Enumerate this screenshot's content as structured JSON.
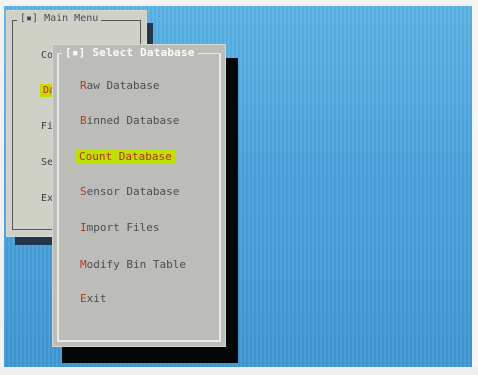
{
  "main_menu": {
    "title": "[▪] Main Menu",
    "items": [
      {
        "label": "Co"
      },
      {
        "label": "Da"
      },
      {
        "label": "Fi"
      },
      {
        "label": "Se"
      },
      {
        "label": "Ex"
      }
    ],
    "selected_index": 1
  },
  "db_dialog": {
    "title": "[▪] Select Database",
    "items": [
      {
        "hot": "R",
        "rest": "aw Database"
      },
      {
        "hot": "B",
        "rest": "inned Database"
      },
      {
        "hot": "C",
        "rest": "ount Database"
      },
      {
        "hot": "S",
        "rest": "ensor Database"
      },
      {
        "hot": "I",
        "rest": "mport Files"
      },
      {
        "hot": "M",
        "rest": "odify Bin Table"
      },
      {
        "hot": "E",
        "rest": "xit"
      }
    ],
    "selected_index": 2
  },
  "colors": {
    "desktop": "#4aa6dd",
    "menu_bg": "#cfd0c6",
    "dialog_bg": "#bcbdb8",
    "highlight": "#bfe000",
    "hotkey": "#bb3518"
  }
}
